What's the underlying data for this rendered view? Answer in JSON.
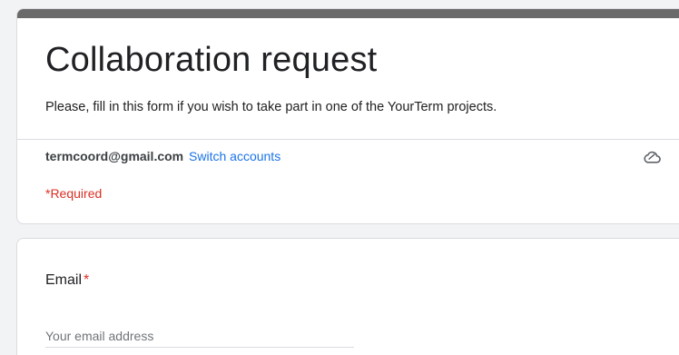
{
  "header": {
    "title": "Collaboration request",
    "description": "Please, fill in this form if you wish to take part in one of the YourTerm projects.",
    "accent_color": "#6a6a6a"
  },
  "account": {
    "email": "termcoord@gmail.com",
    "switch_label": "Switch accounts",
    "status_icon": "cloud-saved-icon"
  },
  "required_note": "*Required",
  "question": {
    "title": "Email",
    "required_marker": "*",
    "placeholder": "Your email address",
    "value": ""
  },
  "colors": {
    "link": "#1a73e8",
    "required": "#d93025"
  }
}
